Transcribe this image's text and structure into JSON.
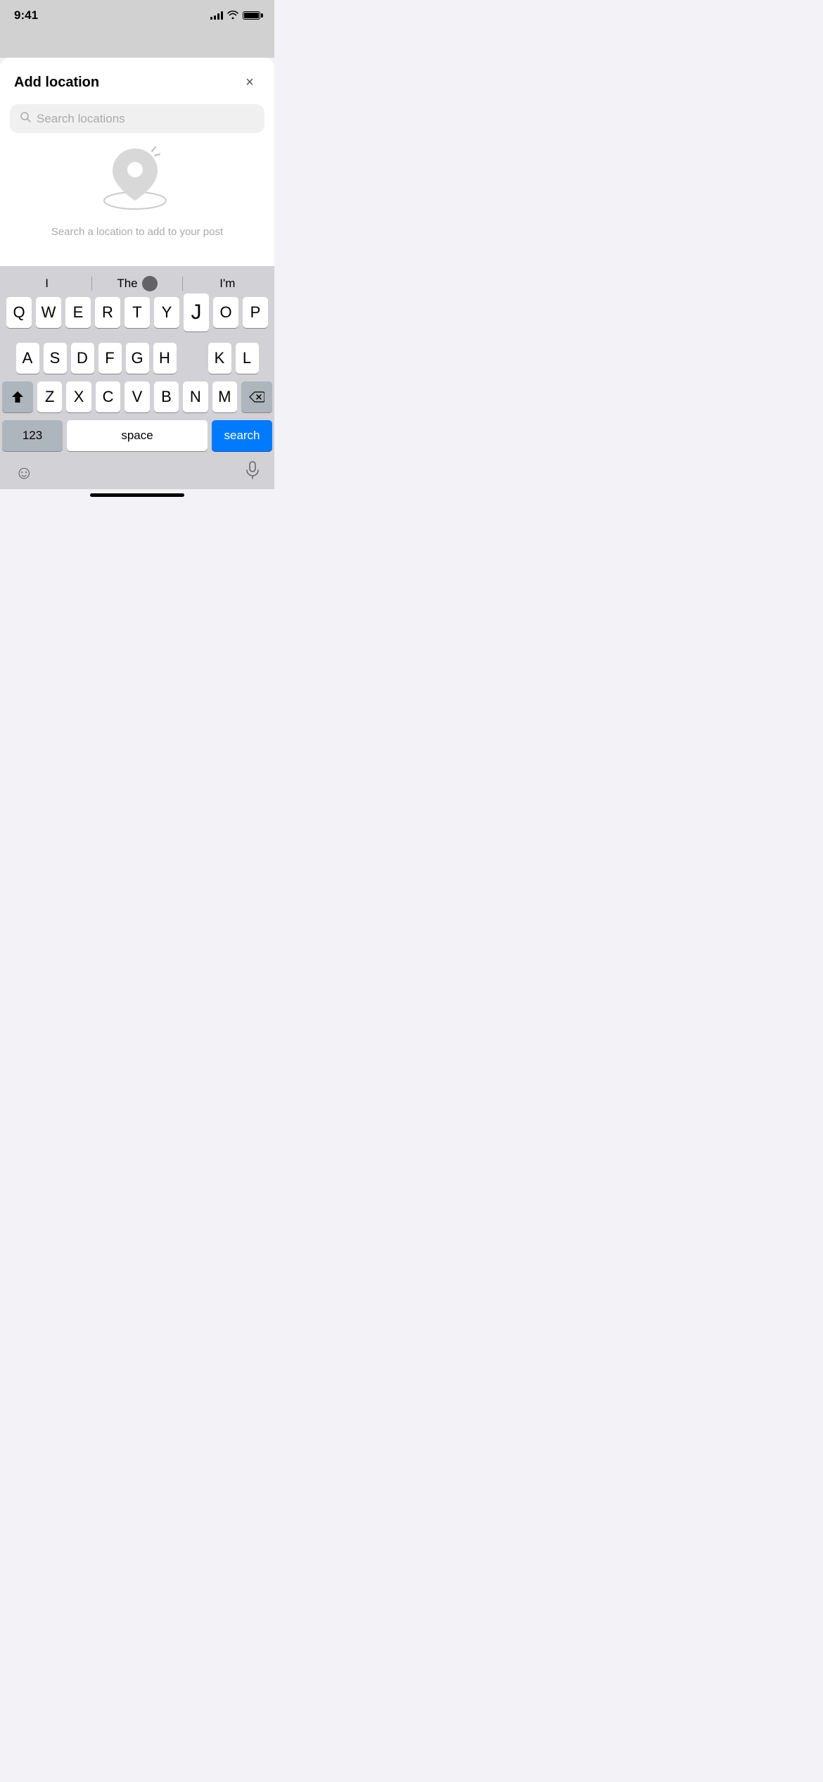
{
  "status_bar": {
    "time": "9:41",
    "signal_label": "signal",
    "wifi_label": "wifi",
    "battery_label": "battery"
  },
  "modal": {
    "title": "Add location",
    "close_label": "×"
  },
  "search": {
    "placeholder": "Search locations"
  },
  "empty_state": {
    "message": "Search a location to add to your post"
  },
  "predictive": {
    "left": "I",
    "middle": "The",
    "right": "I'm"
  },
  "keyboard": {
    "row1": [
      "Q",
      "W",
      "E",
      "R",
      "T",
      "Y",
      "J",
      "O",
      "P"
    ],
    "row2": [
      "A",
      "S",
      "D",
      "F",
      "G",
      "H",
      "K",
      "L"
    ],
    "row3": [
      "Z",
      "X",
      "C",
      "V",
      "B",
      "N",
      "M"
    ],
    "num_label": "123",
    "space_label": "space",
    "search_label": "search"
  }
}
